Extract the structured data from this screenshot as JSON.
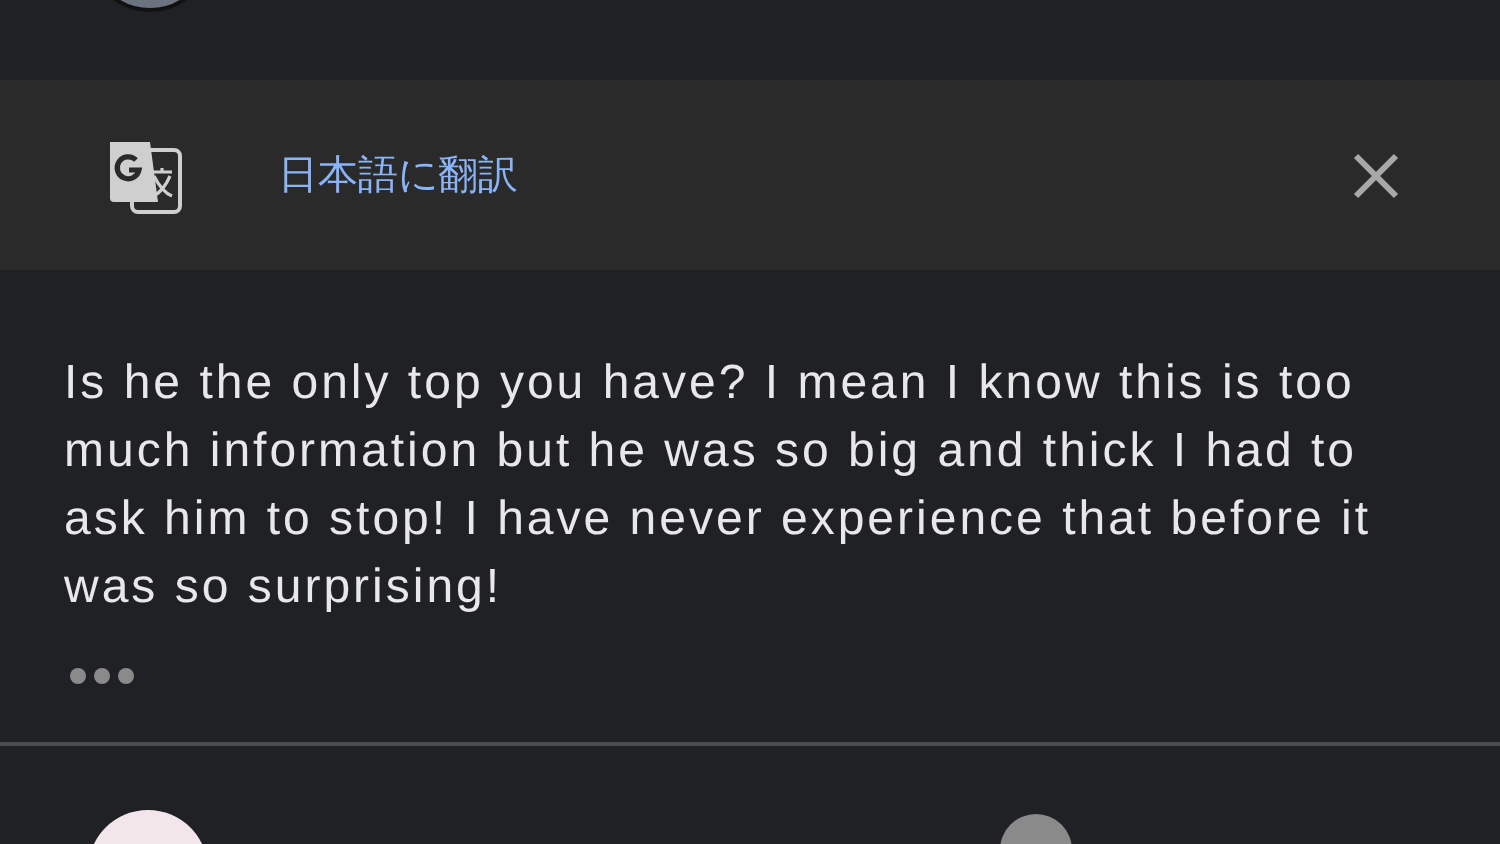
{
  "translate_bar": {
    "label": "日本語に翻訳"
  },
  "comment": {
    "text": "Is he the only top you have? I mean I know this is too much information but he was so big and thick I had to ask him to stop! I have never experience that before it was so surprising!"
  }
}
